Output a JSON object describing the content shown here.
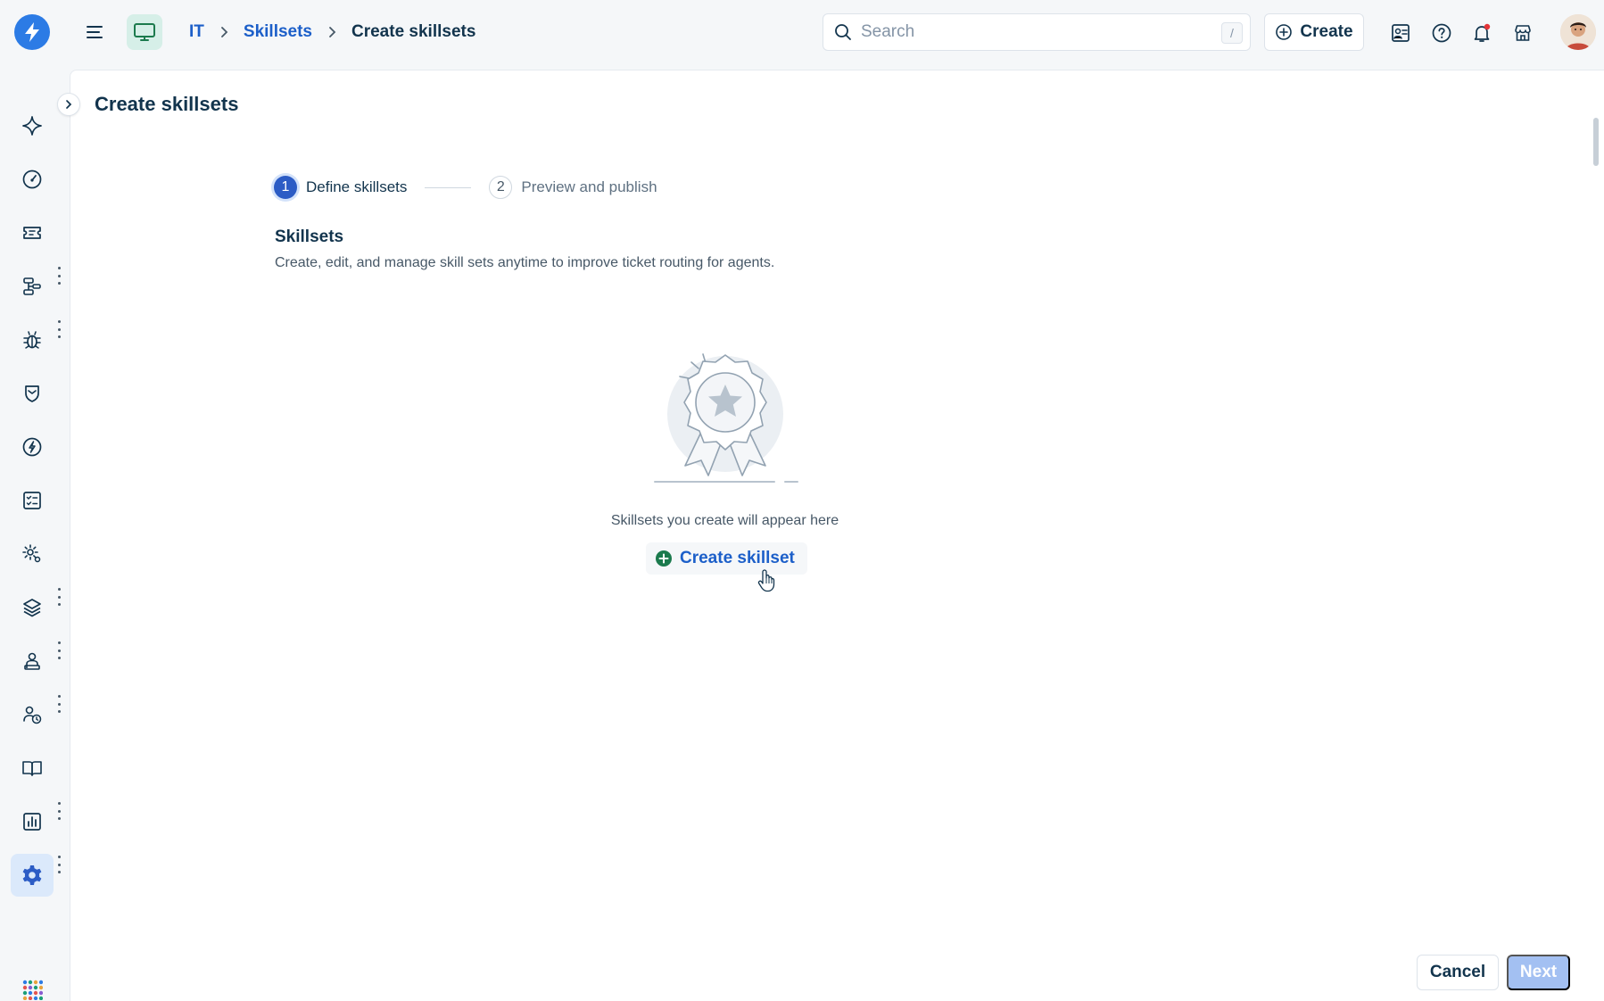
{
  "header": {
    "breadcrumb": [
      "IT",
      "Skillsets",
      "Create skillsets"
    ],
    "search": {
      "placeholder": "Search",
      "shortcut": "/"
    },
    "create_label": "Create"
  },
  "sidebar": {
    "items": [
      {
        "icon": "sparkle-icon"
      },
      {
        "icon": "dashboard-gauge-icon"
      },
      {
        "icon": "ticket-icon",
        "has_more": true
      },
      {
        "icon": "workflow-icon",
        "has_more": true
      },
      {
        "icon": "bug-icon"
      },
      {
        "icon": "shield-icon"
      },
      {
        "icon": "change-icon"
      },
      {
        "icon": "checklist-icon"
      },
      {
        "icon": "automation-gear-icon",
        "has_more": true
      },
      {
        "icon": "layers-icon",
        "has_more": true
      },
      {
        "icon": "agent-desk-icon",
        "has_more": true
      },
      {
        "icon": "user-clock-icon"
      },
      {
        "icon": "book-icon",
        "has_more": true
      },
      {
        "icon": "reports-icon",
        "has_more": true
      },
      {
        "icon": "settings-gear-icon",
        "active": true
      }
    ],
    "apps_icon": "apps-grid-icon"
  },
  "main": {
    "page_title": "Create skillsets",
    "steps": [
      {
        "number": "1",
        "label": "Define skillsets",
        "active": true
      },
      {
        "number": "2",
        "label": "Preview and publish",
        "active": false
      }
    ],
    "section_title": "Skillsets",
    "section_description": "Create, edit, and manage skill sets anytime to improve ticket routing for agents.",
    "empty_state_text": "Skillsets you create will appear here",
    "create_skillset_label": "Create skillset"
  },
  "footer": {
    "cancel_label": "Cancel",
    "next_label": "Next"
  },
  "colors": {
    "brand": "#2c7be5",
    "link": "#1c5fc9",
    "text": "#12344d",
    "next_disabled": "#a3c0f2",
    "add_icon": "#1b7a4d"
  }
}
